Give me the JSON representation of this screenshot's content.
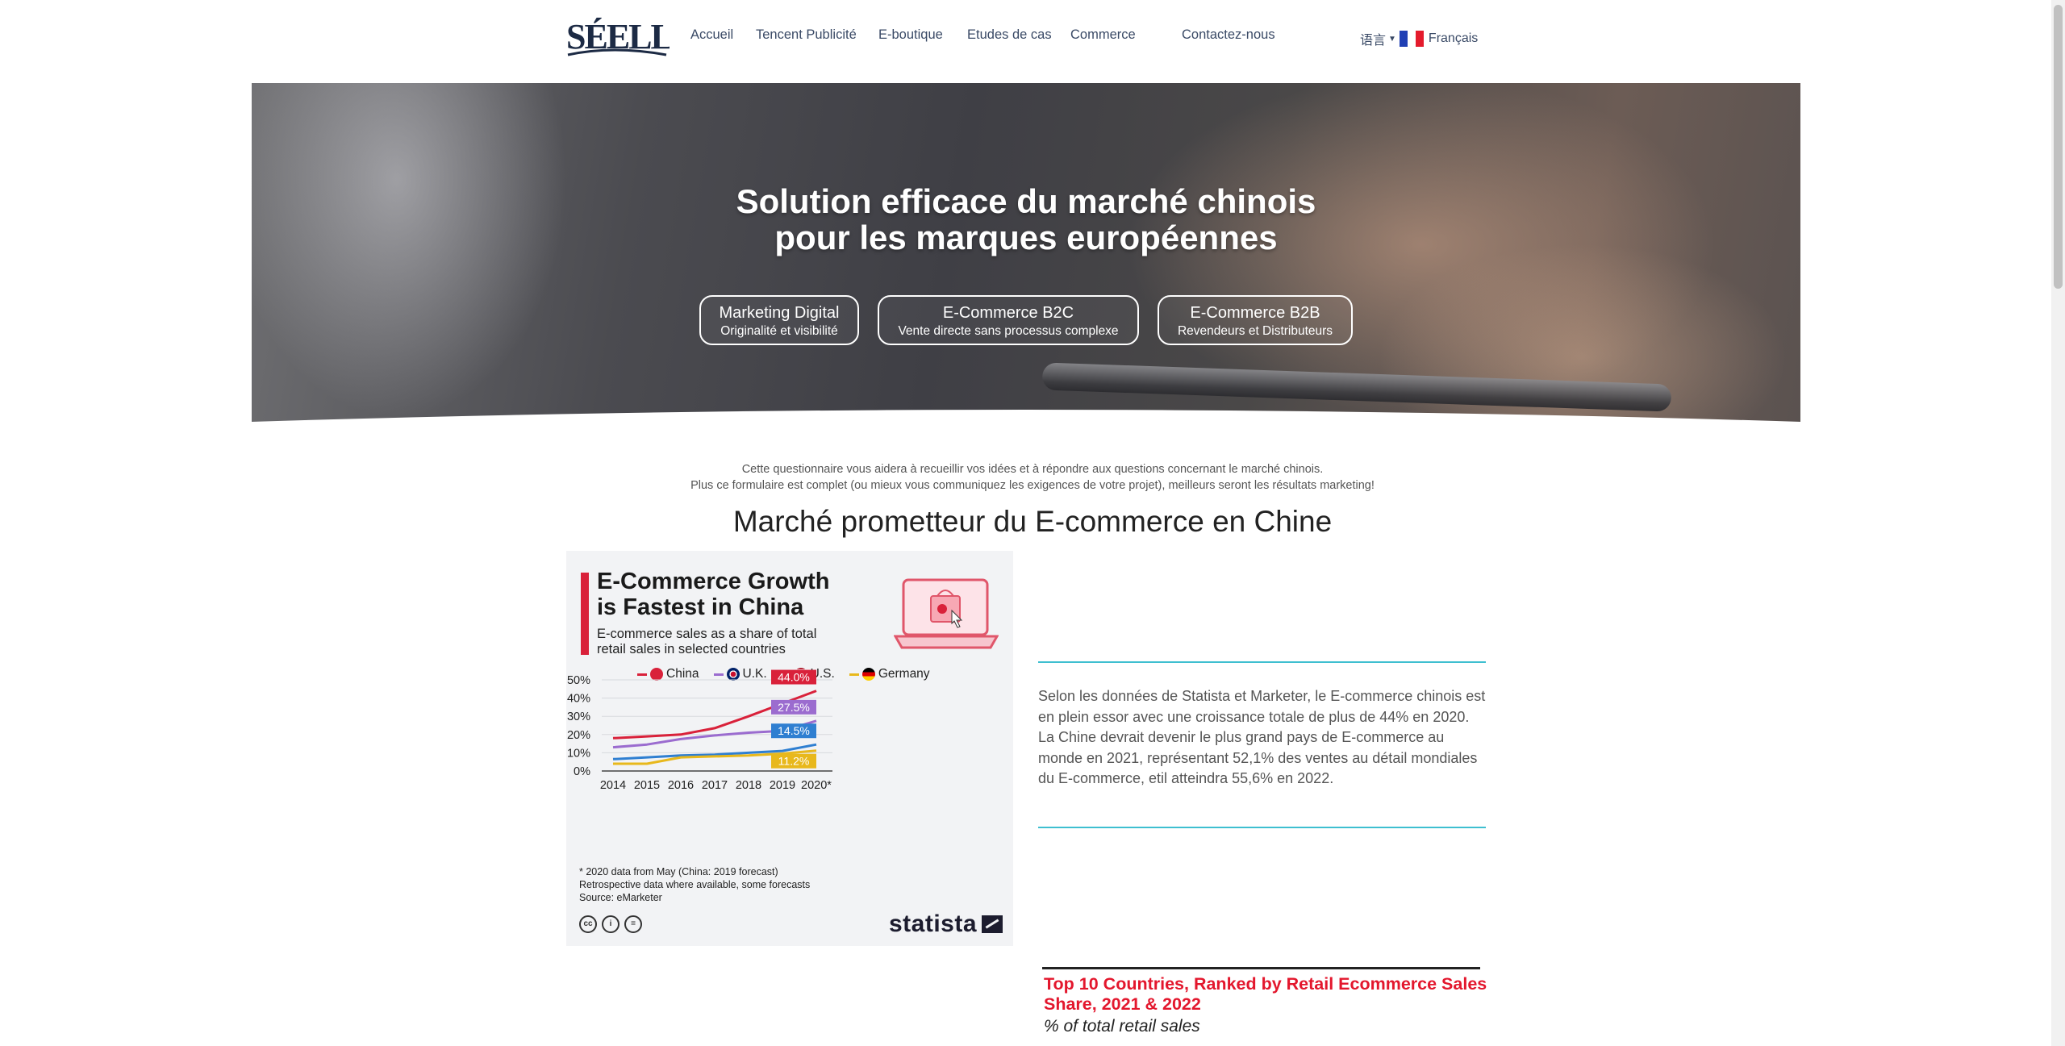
{
  "header": {
    "logo_text": "SÉELLES",
    "nav": [
      "Accueil",
      "Tencent Publicité",
      "E-boutique",
      "Etudes de cas",
      "Commerce",
      "Contactez-nous"
    ],
    "language_label": "语言",
    "current_language": "Français"
  },
  "hero": {
    "title_line1": "Solution efficace du marché chinois",
    "title_line2": "pour les marques européennes",
    "buttons": [
      {
        "title": "Marketing Digital",
        "subtitle": "Originalité et visibilité"
      },
      {
        "title": "E-Commerce B2C",
        "subtitle": "Vente directe sans processus complexe"
      },
      {
        "title": "E-Commerce B2B",
        "subtitle": "Revendeurs et Distributeurs"
      }
    ]
  },
  "intro": {
    "line1": "Cette questionnaire vous aidera à recueillir vos idées et à répondre aux questions concernant le marché chinois.",
    "line2": "Plus ce formulaire est complet (ou mieux vous communiquez les exigences de votre projet), meilleurs seront les résultats marketing!"
  },
  "section_title": "Marché prometteur du E-commerce en Chine",
  "infographic": {
    "title_line1": "E-Commerce Growth",
    "title_line2": "is Fastest in China",
    "subtitle_line1": "E-commerce sales as a share of total",
    "subtitle_line2": "retail sales in selected countries",
    "footnote_line1": "* 2020 data from May (China: 2019 forecast)",
    "footnote_line2": "Retrospective data where available, some forecasts",
    "footnote_line3": "Source: eMarketer",
    "brand": "statista",
    "colors": {
      "China": "#d9213a",
      "U.K.": "#9b6ccf",
      "U.S.": "#2f7fd1",
      "Germany": "#e8b81c"
    }
  },
  "chart_data": {
    "type": "line",
    "title": "E-Commerce Growth is Fastest in China",
    "subtitle": "E-commerce sales as a share of total retail sales in selected countries",
    "x": [
      "2014",
      "2015",
      "2016",
      "2017",
      "2018",
      "2019",
      "2020*"
    ],
    "ylim": [
      0,
      50
    ],
    "yticks": [
      "0%",
      "10%",
      "20%",
      "30%",
      "40%",
      "50%"
    ],
    "series": [
      {
        "name": "China",
        "values": [
          18.0,
          19.0,
          20.0,
          23.5,
          30.0,
          37.0,
          44.0
        ],
        "end_label": "44.0%"
      },
      {
        "name": "U.K.",
        "values": [
          13.0,
          14.5,
          17.5,
          19.5,
          21.0,
          22.0,
          27.5
        ],
        "end_label": "27.5%"
      },
      {
        "name": "U.S.",
        "values": [
          6.5,
          7.5,
          8.5,
          9.0,
          10.0,
          11.0,
          14.5
        ],
        "end_label": "14.5%"
      },
      {
        "name": "Germany",
        "values": [
          4.0,
          4.0,
          7.5,
          8.0,
          8.5,
          9.5,
          11.2
        ],
        "end_label": "11.2%"
      }
    ],
    "legend": "top"
  },
  "description": "Selon les données de Statista et Marketer, le E-commerce chinois est en plein essor avec une croissance totale de plus de 44% en 2020. La Chine devrait devenir le plus grand pays de E-commerce au monde en 2021, représentant 52,1% des ventes au détail mondiales du E-commerce, etil atteindra 55,6% en 2022.",
  "second_chart": {
    "title": "Top 10 Countries, Ranked by Retail Ecommerce Sales Share, 2021 & 2022",
    "subtitle": "% of total retail sales"
  }
}
